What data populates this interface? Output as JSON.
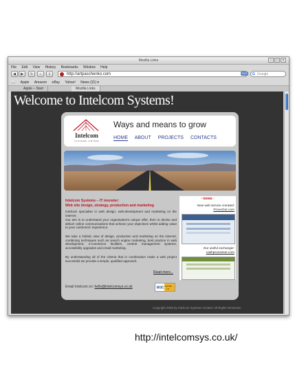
{
  "browser": {
    "window_title": "Mozilla Links",
    "menu": [
      "File",
      "Edit",
      "View",
      "History",
      "Bookmarks",
      "Window",
      "Help"
    ],
    "address": "http://artpaschenko.com",
    "rss_badge": "RSS",
    "search_placeholder": "Google",
    "bookmarks": [
      "Apple",
      "Amazon",
      "eBay",
      "Yahoo!",
      "News (31) ▾"
    ],
    "tabs": [
      "Apple – Start",
      "Mozilla Links"
    ]
  },
  "page": {
    "welcome": "Welcome to Intelcom Systems!",
    "logo": {
      "name": "Intelcom",
      "sub": "SYSTEMS LIMITED"
    },
    "tagline": "Ways and means to grow",
    "nav": [
      "HOME",
      "ABOUT",
      "PROJECTS",
      "CONTACTS"
    ],
    "intro_title_1": "Intelcom Systems – IT monster:",
    "intro_title_2": "Web site design, strategy, production and marketing",
    "paragraphs": [
      "Intelcom specialise in web design, web-development and marketing on the internet.",
      "Our aim is to understand your organisation's unique offer, then to devise and deliver online communications that achieve your objectives whilst adding value to your customers' experience.",
      "We take a holistic view of design, production and marketing on the internet, combining techniques such as search engine marketing, best practice in web development, e-commerce facilities, content management systems, accessibility upgrades and email marketing.",
      "By understanding all of the criteria that in combination make a web project successful we provide a simple, qualified approach."
    ],
    "read_more": "Read more...",
    "news": {
      "header": "· news ·",
      "item1_label": "New web service crerated:",
      "item1_link": "ProveOut.com",
      "item2_label": "Our useful exchanger:",
      "item2_link": "cashprocessor.com"
    },
    "email_label": "Email Intelcom on:",
    "email": "hello@intelcomsys.co.uk",
    "w3c": "W3C XHTML 1.0",
    "copyright": "Copyright 2005 by Intelcom Systems Limited. All Rights Reserved."
  },
  "caption": "http://intelcomsys.co.uk/",
  "colors": {
    "accent_red": "#c0111f",
    "nav_blue": "#2a3a8f",
    "page_bg": "#333333"
  }
}
